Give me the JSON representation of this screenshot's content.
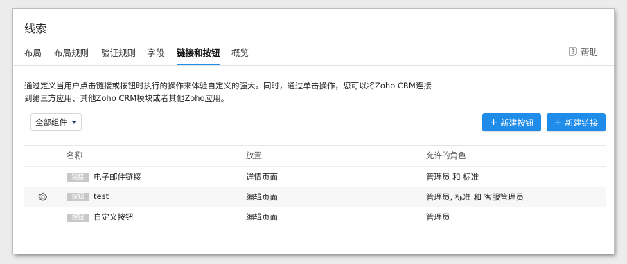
{
  "page": {
    "title": "线索"
  },
  "tabs": [
    {
      "label": "布局",
      "active": false
    },
    {
      "label": "布局规则",
      "active": false
    },
    {
      "label": "验证规则",
      "active": false
    },
    {
      "label": "字段",
      "active": false
    },
    {
      "label": "链接和按钮",
      "active": true
    },
    {
      "label": "概览",
      "active": false
    }
  ],
  "help": {
    "label": "帮助",
    "icon": "help-icon"
  },
  "description": {
    "line1": "通过定义当用户点击链接或按钮时执行的操作来体验自定义的强大。同时，通过单击操作，您可以将Zoho CRM连接",
    "line2": "到第三方应用、其他Zoho CRM模块或者其他Zoho应用。"
  },
  "filter": {
    "label": "全部组件"
  },
  "actions": {
    "new_button": "新建按钮",
    "new_link": "新建链接"
  },
  "table": {
    "headers": {
      "name": "名称",
      "placement": "放置",
      "roles": "允许的角色"
    },
    "rows": [
      {
        "type": "链接",
        "name": "电子邮件链接",
        "placement": "详情页面",
        "roles": "管理员 和 标准",
        "show_gear": false
      },
      {
        "type": "按钮",
        "name": "test",
        "placement": "编辑页面",
        "roles": "管理员, 标准 和 客服管理员",
        "show_gear": true
      },
      {
        "type": "按钮",
        "name": "自定义按钮",
        "placement": "编辑页面",
        "roles": "管理员",
        "show_gear": false
      }
    ]
  },
  "colors": {
    "accent": "#1f8cea",
    "badge": "#c8c8c8"
  }
}
